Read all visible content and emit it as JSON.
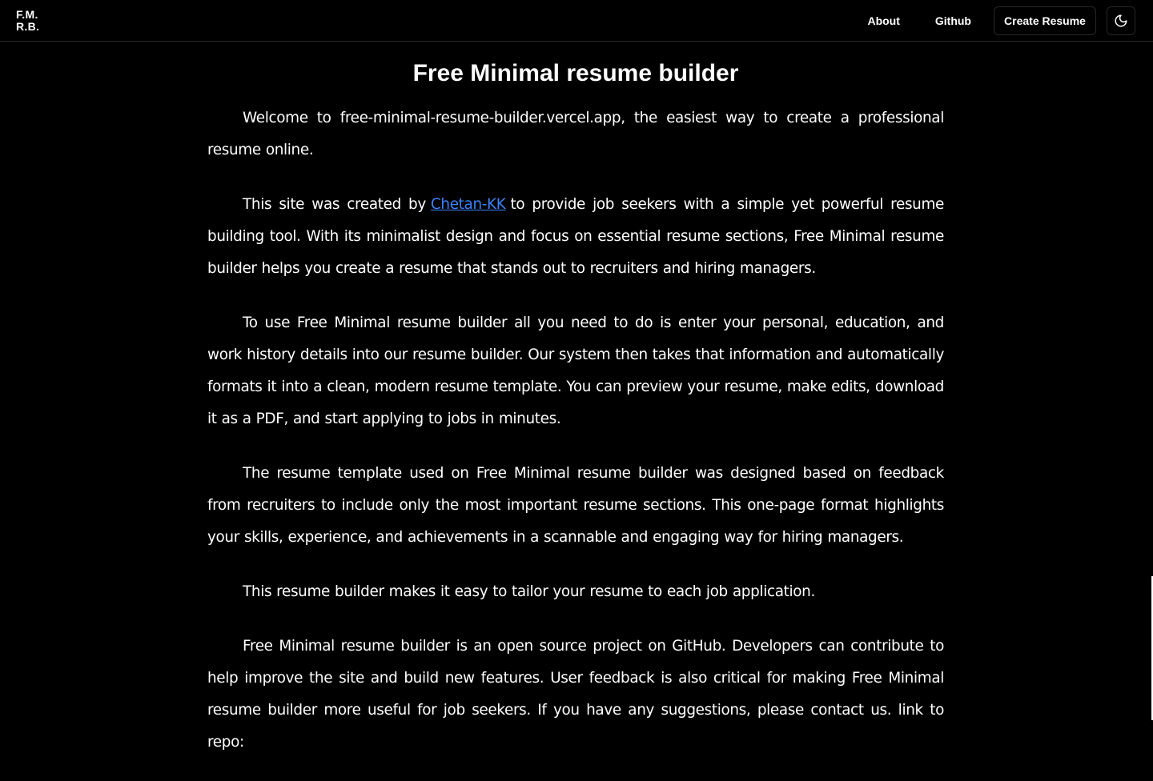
{
  "logo": {
    "line1": "F.M.",
    "line2": "R.B."
  },
  "nav": {
    "about": "About",
    "github": "Github",
    "create_resume": "Create Resume",
    "theme_icon": "moon-icon"
  },
  "main": {
    "title": "Free Minimal resume builder",
    "p1": "Welcome to free-minimal-resume-builder.vercel.app, the easiest way to create a professional resume online.",
    "p2_before": "This site was created by",
    "p2_link": "Chetan-KK",
    "p2_after": "to provide job seekers with a simple yet powerful resume building tool. With its minimalist design and focus on essential resume sections, Free Minimal resume builder helps you create a resume that stands out to recruiters and hiring managers.",
    "p3": "To use Free Minimal resume builder all you need to do is enter your personal, education, and work history details into our resume builder. Our system then takes that information and automatically formats it into a clean, modern resume template. You can preview your resume, make edits, download it as a PDF, and start applying to jobs in minutes.",
    "p4": "The resume template used on Free Minimal resume builder was designed based on feedback from recruiters to include only the most important resume sections. This one-page format highlights your skills, experience, and achievements in a scannable and engaging way for hiring managers.",
    "p5": "This resume builder makes it easy to tailor your resume to each job application.",
    "p6": "Free Minimal resume builder is an open source project on GitHub. Developers can contribute to help improve the site and build new features. User feedback is also critical for making Free Minimal resume builder more useful for job seekers. If you have any suggestions, please contact us. link to repo:"
  },
  "colors": {
    "background": "#000000",
    "text": "#ffffff",
    "link": "#3b82f6",
    "border": "#27272a"
  }
}
